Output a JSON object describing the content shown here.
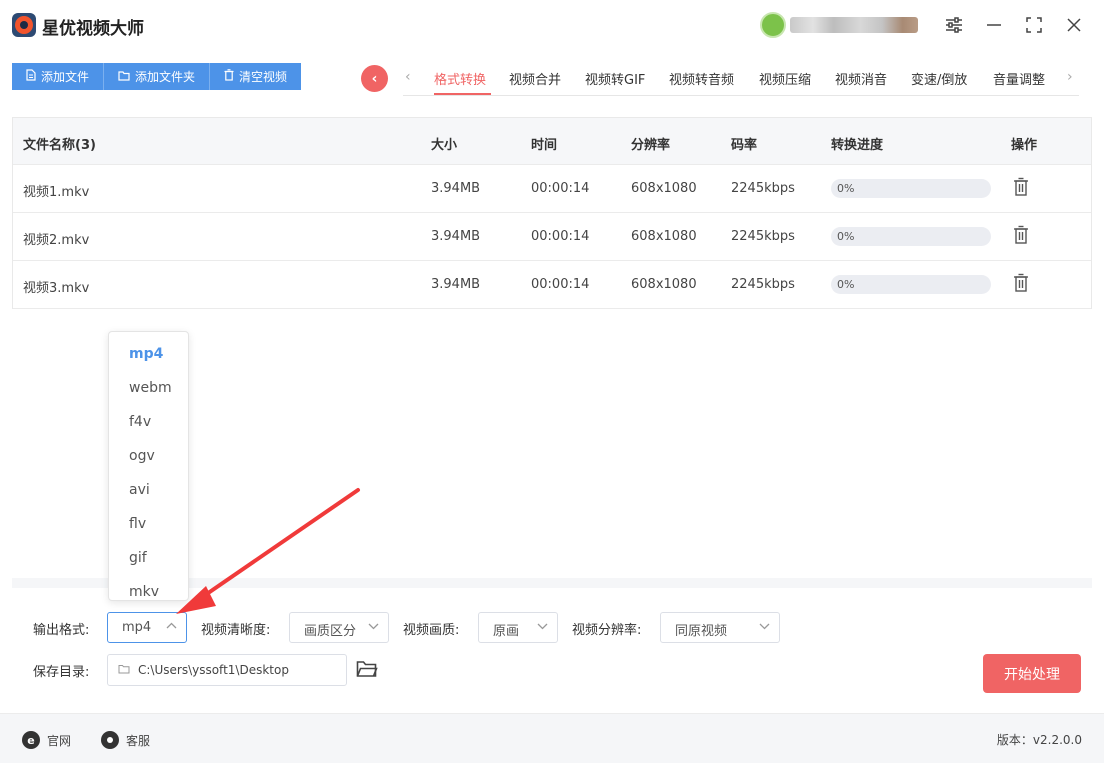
{
  "app": {
    "title": "星优视频大师"
  },
  "window": {
    "settings_icon": "sliders-icon",
    "minimize": "—",
    "maximize": "⛶",
    "close": "✕"
  },
  "toolbar": {
    "add_file": "添加文件",
    "add_folder": "添加文件夹",
    "clear_videos": "清空视频"
  },
  "tabs": [
    {
      "label": "格式转换",
      "active": true
    },
    {
      "label": "视频合并"
    },
    {
      "label": "视频转GIF"
    },
    {
      "label": "视频转音频"
    },
    {
      "label": "视频压缩"
    },
    {
      "label": "视频消音"
    },
    {
      "label": "变速/倒放"
    },
    {
      "label": "音量调整"
    }
  ],
  "table": {
    "headers": [
      "文件名称(3)",
      "大小",
      "时间",
      "分辨率",
      "码率",
      "转换进度",
      "操作"
    ],
    "rows": [
      {
        "name": "视频1.mkv",
        "size": "3.94MB",
        "duration": "00:00:14",
        "resolution": "608x1080",
        "bitrate": "2245kbps",
        "progress": "0%",
        "progress_value": 0
      },
      {
        "name": "视频2.mkv",
        "size": "3.94MB",
        "duration": "00:00:14",
        "resolution": "608x1080",
        "bitrate": "2245kbps",
        "progress": "0%",
        "progress_value": 0
      },
      {
        "name": "视频3.mkv",
        "size": "3.94MB",
        "duration": "00:00:14",
        "resolution": "608x1080",
        "bitrate": "2245kbps",
        "progress": "0%",
        "progress_value": 0
      }
    ]
  },
  "format_dropdown": {
    "options": [
      "mp4",
      "webm",
      "f4v",
      "ogv",
      "avi",
      "flv",
      "gif",
      "mkv"
    ],
    "selected": "mp4"
  },
  "settings": {
    "output_format_label": "输出格式:",
    "output_format_value": "mp4",
    "clarity_label": "视频清晰度:",
    "clarity_value": "画质区分",
    "quality_label": "视频画质:",
    "quality_value": "原画",
    "resolution_label": "视频分辨率:",
    "resolution_value": "同原视频",
    "save_dir_label": "保存目录:",
    "save_dir_value": "C:\\Users\\yssoft1\\Desktop",
    "start_button": "开始处理"
  },
  "statusbar": {
    "website": "官网",
    "support": "客服",
    "version": "版本：v2.2.0.0"
  },
  "colors": {
    "accent_blue": "#4d93e8",
    "accent_red": "#f06464"
  }
}
